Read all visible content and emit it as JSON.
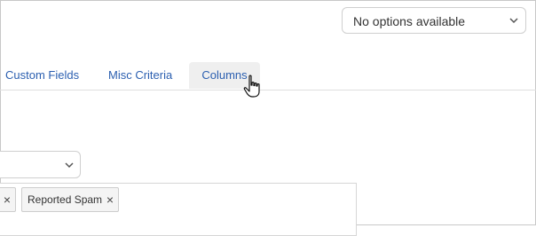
{
  "top_select": {
    "value": "No options available",
    "icon": "chevron-down-icon"
  },
  "tabs": [
    {
      "label": "Custom Fields",
      "active": false
    },
    {
      "label": "Misc Criteria",
      "active": false
    },
    {
      "label": "Columns",
      "active": true
    }
  ],
  "tags": {
    "partial_remove": "×",
    "items": [
      {
        "label": "Reported Spam",
        "remove": "×"
      }
    ]
  },
  "colors": {
    "tab_link": "#2b5fb0",
    "active_tab_bg": "#efefef"
  }
}
